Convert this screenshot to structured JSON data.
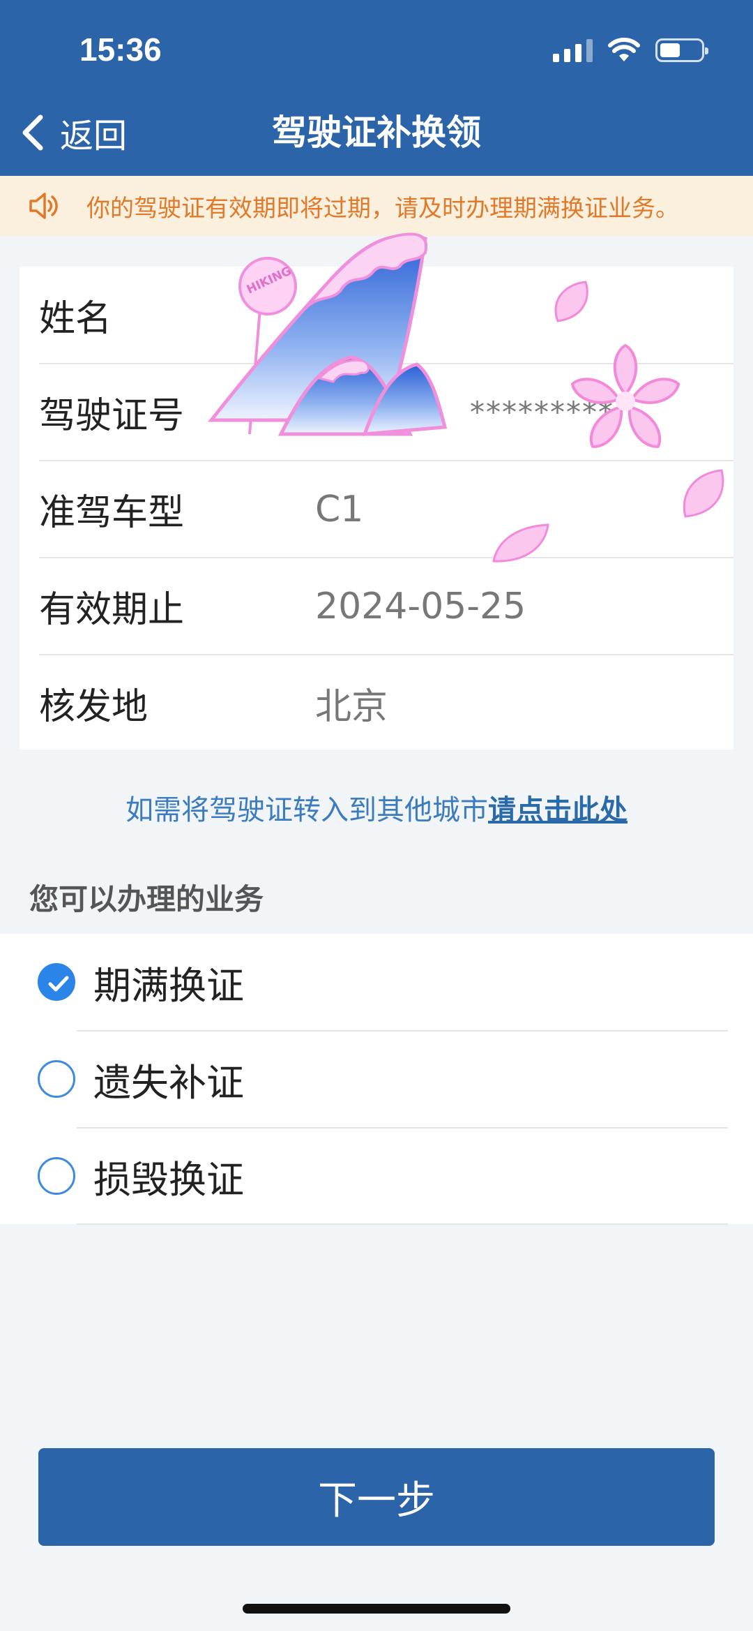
{
  "status_bar": {
    "time": "15:36"
  },
  "nav": {
    "back_label": "返回",
    "title": "驾驶证补换领"
  },
  "notice": {
    "text": "你的驾驶证有效期即将过期，请及时办理期满换证业务。",
    "color": "#e07a2a"
  },
  "license_info": {
    "rows": [
      {
        "label": "姓名",
        "value": ""
      },
      {
        "label": "驾驶证号",
        "value": "*********"
      },
      {
        "label": "准驾车型",
        "value": "C1"
      },
      {
        "label": "有效期止",
        "value": "2024-05-25"
      },
      {
        "label": "核发地",
        "value": "北京"
      }
    ]
  },
  "transfer": {
    "prefix": "如需将驾驶证转入到其他城市",
    "link": "请点击此处"
  },
  "services": {
    "title": "您可以办理的业务",
    "options": [
      {
        "label": "期满换证",
        "checked": true
      },
      {
        "label": "遗失补证",
        "checked": false
      },
      {
        "label": "损毁换证",
        "checked": false
      }
    ]
  },
  "next_button": {
    "label": "下一步"
  },
  "sticker": {
    "text": "HIKING"
  },
  "colors": {
    "primary": "#2b64a8",
    "accent": "#2b85e8",
    "notice_bg": "#fbefdd"
  }
}
